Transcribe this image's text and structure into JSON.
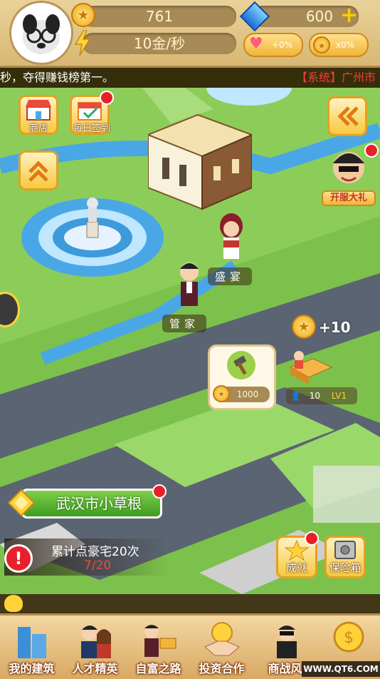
{
  "hud": {
    "gold": "761",
    "income": "10金/秒",
    "diamonds": "600",
    "heart_buff": "+0%",
    "coin_buff": "x0%"
  },
  "ticker": {
    "left_text": "秒，夺得赚钱榜第一。",
    "right_text": "【系统】广州市"
  },
  "map": {
    "shop_label": "商店",
    "daily_checkin_label": "每日签到",
    "vip_gift_label": "开服大礼",
    "npc_shengyan": "盛宴",
    "npc_guanjia": "管家",
    "build_cost": "1000",
    "coin_popup": "+10",
    "worker_count": "10",
    "worker_level": "LV1",
    "rank_title": "武汉市小草根",
    "quest_text": "累计点豪宅20次",
    "quest_progress": "7/20",
    "achievement_label": "成就",
    "safe_label": "保险箱"
  },
  "bottom_nav": [
    {
      "label": "我的建筑"
    },
    {
      "label": "人才精英"
    },
    {
      "label": "自富之路"
    },
    {
      "label": "投资合作"
    },
    {
      "label": "商战风"
    }
  ],
  "watermark": "WWW.QT6.COM",
  "colors": {
    "accent": "#f7c93e",
    "red_dot": "#e8202a",
    "road": "#5b6472",
    "grass": "#8ccd5a"
  }
}
